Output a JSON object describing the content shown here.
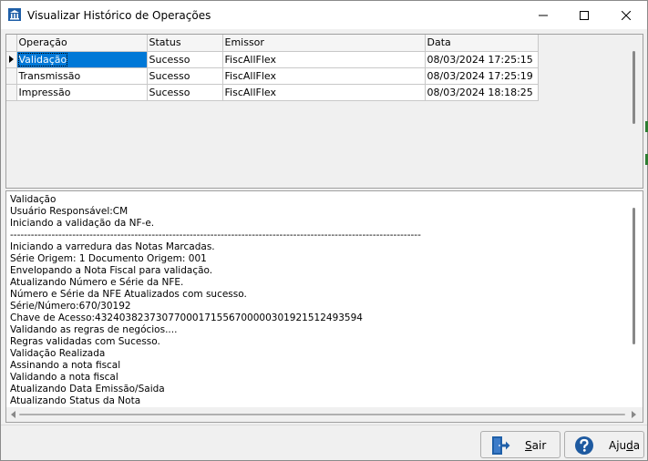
{
  "window": {
    "title": "Visualizar Histórico de Operações"
  },
  "grid": {
    "columns": [
      "Operação",
      "Status",
      "Emissor",
      "Data"
    ],
    "rows": [
      {
        "operacao": "Validação",
        "status": "Sucesso",
        "emissor": "FiscAllFlex",
        "data": "08/03/2024 17:25:15",
        "selected": true
      },
      {
        "operacao": "Transmissão",
        "status": "Sucesso",
        "emissor": "FiscAllFlex",
        "data": "08/03/2024 17:25:19",
        "selected": false
      },
      {
        "operacao": "Impressão",
        "status": "Sucesso",
        "emissor": "FiscAllFlex",
        "data": "08/03/2024 18:18:25",
        "selected": false
      }
    ]
  },
  "log": {
    "lines": [
      "Validação",
      "Usuário Responsável:CM",
      "Iniciando a validação da NF-e.",
      "-----------------------------------------------------------------------------------------------------------------------",
      "Iniciando a varredura das Notas Marcadas.",
      "Série Origem: 1 Documento Origem: 001",
      "Envelopando a Nota Fiscal para validação.",
      "Atualizando Número e Série da NFE.",
      "Número e Série da NFE Atualizados com sucesso.",
      "Série/Número:670/30192",
      "Chave de Acesso:43240382373077000171556700000301921512493594",
      "Validando as regras de negócios....",
      "Regras validadas com Sucesso.",
      "Validação Realizada",
      "Assinando a nota fiscal",
      "Validando a nota fiscal",
      "Atualizando Data Emissão/Saida",
      "Atualizando Status da Nota"
    ]
  },
  "buttons": {
    "sair": {
      "prefix": "",
      "accel": "S",
      "rest": "air"
    },
    "ajuda": {
      "prefix": "Aju",
      "accel": "d",
      "rest": "a"
    }
  },
  "colors": {
    "selection": "#0078d7",
    "window_bg": "#f0f0f0",
    "exit_icon": "#1f5fa8",
    "help_icon": "#1e5aa0"
  },
  "icons": {
    "app": "building-icon",
    "minimize": "minimize-icon",
    "maximize": "maximize-icon",
    "close": "close-icon",
    "sair": "exit-door-icon",
    "ajuda": "help-question-icon"
  }
}
